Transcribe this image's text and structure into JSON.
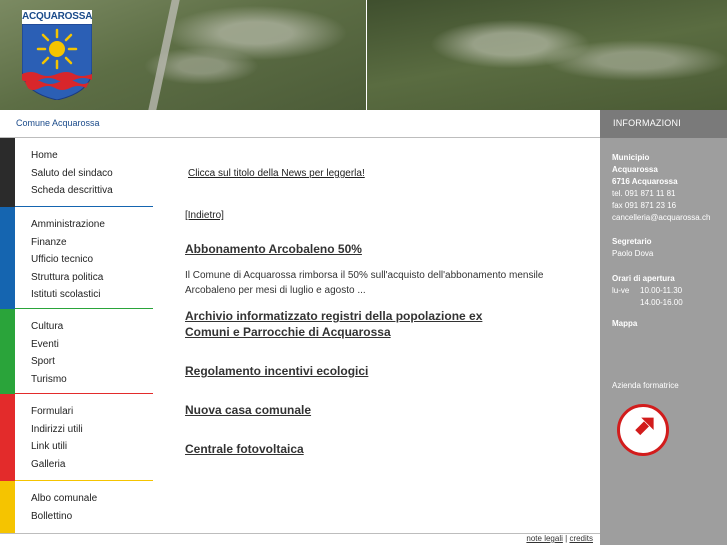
{
  "header": {
    "logo_text": "ACQUAROSSA",
    "breadcrumb": "Comune Acquarossa"
  },
  "colors": {
    "group1": "#2b2b2b",
    "group2": "#1565b0",
    "group3": "#2aa43a",
    "group4": "#e32b2b",
    "group5": "#f5c400",
    "info_panel": "#9e9e9e",
    "link": "#1a4a8a"
  },
  "nav": {
    "groups": [
      {
        "items": [
          "Home",
          "Saluto del sindaco",
          "Scheda descrittiva"
        ]
      },
      {
        "items": [
          "Amministrazione",
          "Finanze",
          "Ufficio tecnico",
          "Struttura politica",
          "Istituti scolastici"
        ]
      },
      {
        "items": [
          "Cultura",
          "Eventi",
          "Sport",
          "Turismo"
        ]
      },
      {
        "items": [
          "Formulari",
          "Indirizzi utili",
          "Link utili",
          "Galleria"
        ]
      },
      {
        "items": [
          "Albo comunale",
          "Bollettino"
        ]
      }
    ]
  },
  "content": {
    "hint": "Clicca sul titolo della News per leggerla!",
    "back": "[Indietro]",
    "news": [
      {
        "title": "Abbonamento Arcobaleno 50%",
        "body": "Il Comune di Acquarossa rimborsa il 50% sull'acquisto dell'abbonamento mensile Arcobaleno per mesi di luglio e agosto ..."
      },
      {
        "title": "Archivio informatizzato registri della popolazione ex Comuni e Parrocchie di Acquarossa",
        "body": ""
      },
      {
        "title": "Regolamento incentivi ecologici",
        "body": ""
      },
      {
        "title": "Nuova casa comunale",
        "body": ""
      },
      {
        "title": "Centrale fotovoltaica",
        "body": ""
      }
    ]
  },
  "info": {
    "header": "INFORMAZIONI",
    "municipio_label": "Municipio",
    "municipio_name": "Acquarossa",
    "address": "6716 Acquarossa",
    "tel": "tel. 091 871 11 81",
    "fax": "fax 091 871 23 16",
    "email": "cancelleria@acquarossa.ch",
    "segretario_label": "Segretario",
    "segretario_name": "Paolo Dova",
    "orari_label": "Orari di apertura",
    "orari_days": "lu-ve",
    "orari_1": "10.00-11.30",
    "orari_2": "14.00-16.00",
    "map_link": "Mappa",
    "azienda": "Azienda formatrice"
  },
  "footer": {
    "legal": "note legali",
    "separator": "|",
    "credits": "credits"
  }
}
